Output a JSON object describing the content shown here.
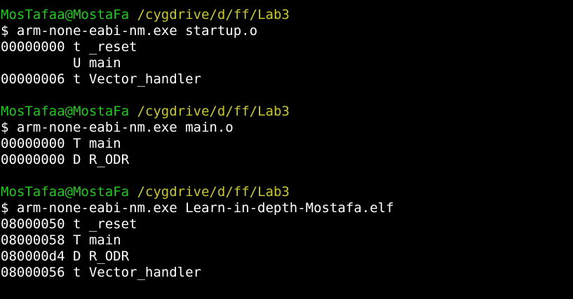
{
  "colors": {
    "background": "#000000",
    "user_host": "#24c824",
    "path": "#c8c832",
    "text": "#ffffff"
  },
  "blocks": [
    {
      "prompt_user": "MosTafaa@MostaFa",
      "prompt_path": "/cygdrive/d/ff/Lab3",
      "command": "$ arm-none-eabi-nm.exe startup.o",
      "output": [
        "00000000 t _reset",
        "         U main",
        "00000006 t Vector_handler"
      ]
    },
    {
      "prompt_user": "MosTafaa@MostaFa",
      "prompt_path": "/cygdrive/d/ff/Lab3",
      "command": "$ arm-none-eabi-nm.exe main.o",
      "output": [
        "00000000 T main",
        "00000000 D R_ODR"
      ]
    },
    {
      "prompt_user": "MosTafaa@MostaFa",
      "prompt_path": "/cygdrive/d/ff/Lab3",
      "command": "$ arm-none-eabi-nm.exe Learn-in-depth-Mostafa.elf",
      "output": [
        "08000050 t _reset",
        "08000058 T main",
        "080000d4 D R_ODR",
        "08000056 t Vector_handler"
      ]
    }
  ]
}
